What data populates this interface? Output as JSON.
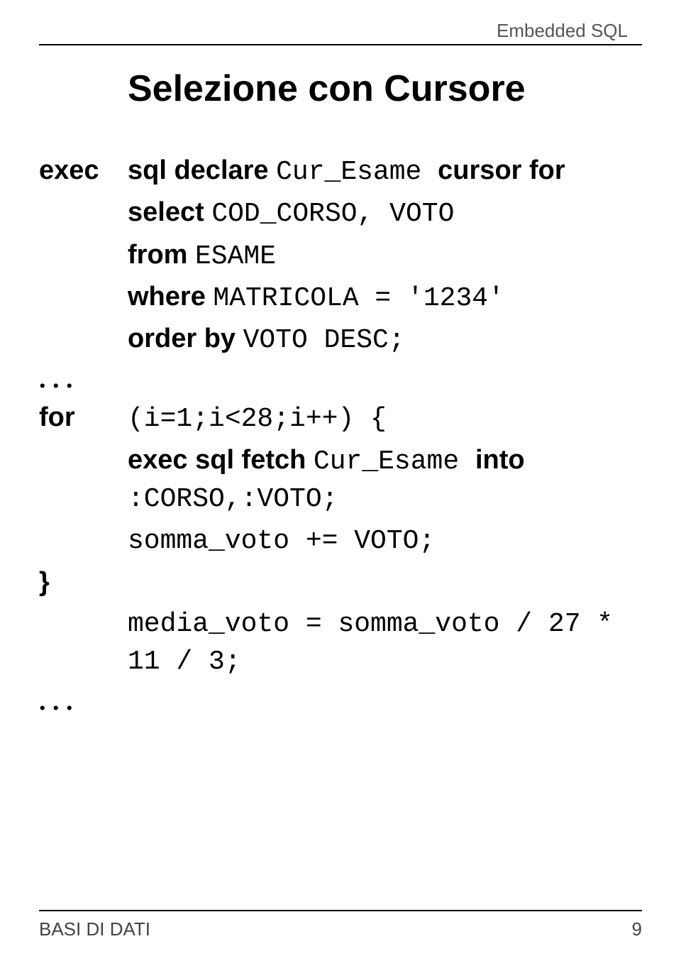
{
  "header": {
    "topic": "Embedded SQL"
  },
  "title": "Selezione con Cursore",
  "code": {
    "rows": [
      {
        "label": "exec",
        "parts": [
          {
            "kw": "sql declare "
          },
          {
            "tt": "Cur_Esame "
          },
          {
            "kw": "cursor for"
          }
        ]
      },
      {
        "label": "",
        "parts": [
          {
            "kw": "select "
          },
          {
            "tt": "COD_CORSO, VOTO"
          }
        ]
      },
      {
        "label": "",
        "parts": [
          {
            "kw": "from "
          },
          {
            "tt": "ESAME"
          }
        ]
      },
      {
        "label": "",
        "parts": [
          {
            "kw": "where "
          },
          {
            "tt": "MATRICOLA = '1234'"
          }
        ]
      },
      {
        "label": "",
        "parts": [
          {
            "kw": "order by "
          },
          {
            "tt": "VOTO DESC;"
          }
        ]
      },
      {
        "label": ". . .",
        "dots": true,
        "parts": []
      },
      {
        "label": "for",
        "parts": [
          {
            "tt": "(i=1;i<28;i++) {"
          }
        ]
      },
      {
        "label": "",
        "parts": [
          {
            "kw": "exec sql fetch "
          },
          {
            "tt": "Cur_Esame "
          },
          {
            "kw": "into "
          },
          {
            "tt": ":CORSO,:VOTO;"
          }
        ]
      },
      {
        "label": "",
        "parts": [
          {
            "tt": "somma_voto += VOTO;"
          }
        ]
      },
      {
        "label": "}",
        "parts": []
      },
      {
        "label": "",
        "parts": [
          {
            "tt": "media_voto = somma_voto / 27 * 11 / 3;"
          }
        ]
      },
      {
        "label": ". . .",
        "dots": true,
        "parts": []
      }
    ]
  },
  "footer": {
    "left": "BASI DI DATI",
    "right": "9"
  }
}
